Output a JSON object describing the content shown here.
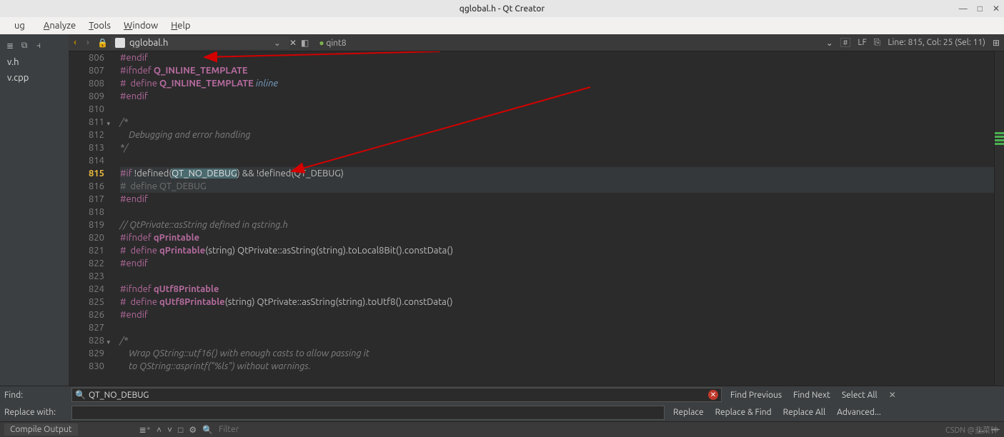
{
  "window": {
    "title": "qglobal.h - Qt Creator"
  },
  "menu": {
    "items": [
      "ug",
      "Analyze",
      "Tools",
      "Window",
      "Help"
    ]
  },
  "sidebar": {
    "files": [
      "v.h",
      "v.cpp"
    ]
  },
  "editor": {
    "file_name": "qglobal.h",
    "symbol_name": "qint8",
    "line_ending": "LF",
    "encoding_icon": "#",
    "file_icon": "⎘",
    "status_line": "Line: 815, Col: 25 (Sel: 11)"
  },
  "code": {
    "lines": [
      {
        "n": 806,
        "type": "pp",
        "text": "#endif"
      },
      {
        "n": 807,
        "type": "ifndef",
        "text": "#ifndef Q_INLINE_TEMPLATE"
      },
      {
        "n": 808,
        "type": "define1",
        "text": "#  define Q_INLINE_TEMPLATE inline"
      },
      {
        "n": 809,
        "type": "pp",
        "text": "#endif"
      },
      {
        "n": 810,
        "type": "blank",
        "text": ""
      },
      {
        "n": 811,
        "type": "cm",
        "text": "/*",
        "fold": true
      },
      {
        "n": 812,
        "type": "cm",
        "text": "    Debugging and error handling"
      },
      {
        "n": 813,
        "type": "cm",
        "text": "*/"
      },
      {
        "n": 814,
        "type": "blank",
        "text": ""
      },
      {
        "n": 815,
        "type": "current",
        "text": "#if !defined(QT_NO_DEBUG) && !defined(QT_DEBUG)",
        "selected": "QT_NO_DEBUG"
      },
      {
        "n": 816,
        "type": "gray",
        "text": "#  define QT_DEBUG"
      },
      {
        "n": 817,
        "type": "pp",
        "text": "#endif"
      },
      {
        "n": 818,
        "type": "blank",
        "text": ""
      },
      {
        "n": 819,
        "type": "cm",
        "text": "// QtPrivate::asString defined in qstring.h"
      },
      {
        "n": 820,
        "type": "ifndef2",
        "text": "#ifndef qPrintable"
      },
      {
        "n": 821,
        "type": "define2",
        "text": "#  define qPrintable(string) QtPrivate::asString(string).toLocal8Bit().constData()"
      },
      {
        "n": 822,
        "type": "pp",
        "text": "#endif"
      },
      {
        "n": 823,
        "type": "blank",
        "text": ""
      },
      {
        "n": 824,
        "type": "ifndef2",
        "text": "#ifndef qUtf8Printable"
      },
      {
        "n": 825,
        "type": "define2",
        "text": "#  define qUtf8Printable(string) QtPrivate::asString(string).toUtf8().constData()"
      },
      {
        "n": 826,
        "type": "pp",
        "text": "#endif"
      },
      {
        "n": 827,
        "type": "blank",
        "text": ""
      },
      {
        "n": 828,
        "type": "cm",
        "text": "/*",
        "fold": true
      },
      {
        "n": 829,
        "type": "cm",
        "text": "    Wrap QString::utf16() with enough casts to allow passing it"
      },
      {
        "n": 830,
        "type": "cm",
        "text": "    to QString::asprintf(\"%ls\") without warnings."
      }
    ]
  },
  "search": {
    "find_label": "Find:",
    "replace_label": "Replace with:",
    "find_value": "QT_NO_DEBUG",
    "replace_value": "",
    "find_previous": "Find Previous",
    "find_next": "Find Next",
    "select_all": "Select All",
    "btn_replace": "Replace",
    "btn_replace_find": "Replace & Find",
    "btn_replace_all": "Replace All",
    "btn_advanced": "Advanced..."
  },
  "bottom": {
    "tab": "Compile Output",
    "filter_placeholder": "Filter"
  },
  "watermark": "CSDN @韭菜钟"
}
